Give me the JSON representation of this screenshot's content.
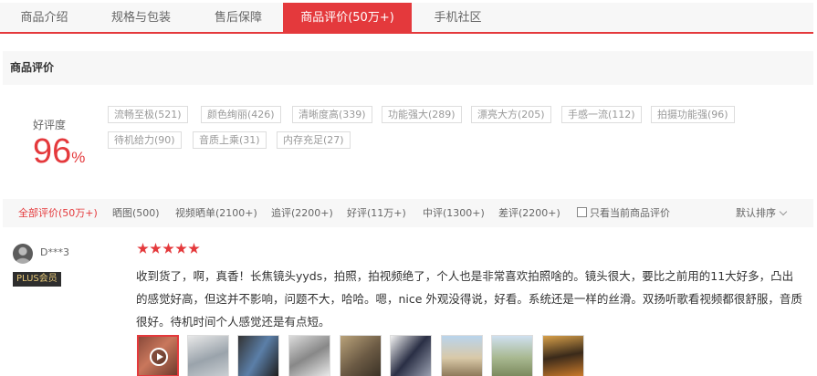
{
  "tabs": [
    {
      "label": "商品介绍"
    },
    {
      "label": "规格与包装"
    },
    {
      "label": "售后保障"
    },
    {
      "label": "商品评价(50万+)",
      "active": true
    },
    {
      "label": "手机社区"
    }
  ],
  "section_title": "商品评价",
  "rating": {
    "label": "好评度",
    "value": "96",
    "unit": "%"
  },
  "tags": [
    "流畅至极(521)",
    "颜色绚丽(426)",
    "清晰度高(339)",
    "功能强大(289)",
    "漂亮大方(205)",
    "手感一流(112)",
    "拍摄功能强(96)",
    "待机给力(90)",
    "音质上乘(31)",
    "内存充足(27)"
  ],
  "filters": [
    {
      "label": "全部评价(50万+)",
      "active": true
    },
    {
      "label": "晒图(500)"
    },
    {
      "label": "视频晒单(2100+)"
    },
    {
      "label": "追评(2200+)"
    },
    {
      "label": "好评(11万+)"
    },
    {
      "label": "中评(1300+)"
    },
    {
      "label": "差评(2200+)"
    }
  ],
  "only_current": "只看当前商品评价",
  "sort_label": "默认排序",
  "review": {
    "user": "D***3",
    "badge": "PLUS会员",
    "stars": 5,
    "text": "收到货了，啊，真香！长焦镜头yyds，拍照，拍视频绝了，个人也是非常喜欢拍照啥的。镜头很大，要比之前用的11大好多，凸出的感觉好高，但这并不影响，问题不大，哈哈。嗯，nice 外观没得说，好看。系统还是一样的丝滑。双扬听歌看视频都很舒服，音质很好。待机时间个人感觉还是有点短。",
    "images": [
      "video-thumbnail",
      "phone-photo",
      "phone-photo",
      "phone-photo",
      "phone-photo",
      "phone-photo",
      "landscape-photo",
      "landscape-photo",
      "landscape-photo"
    ]
  },
  "colors": {
    "accent": "#e4393c",
    "badge_bg": "#2e2e2e",
    "badge_text": "#e6c878"
  }
}
